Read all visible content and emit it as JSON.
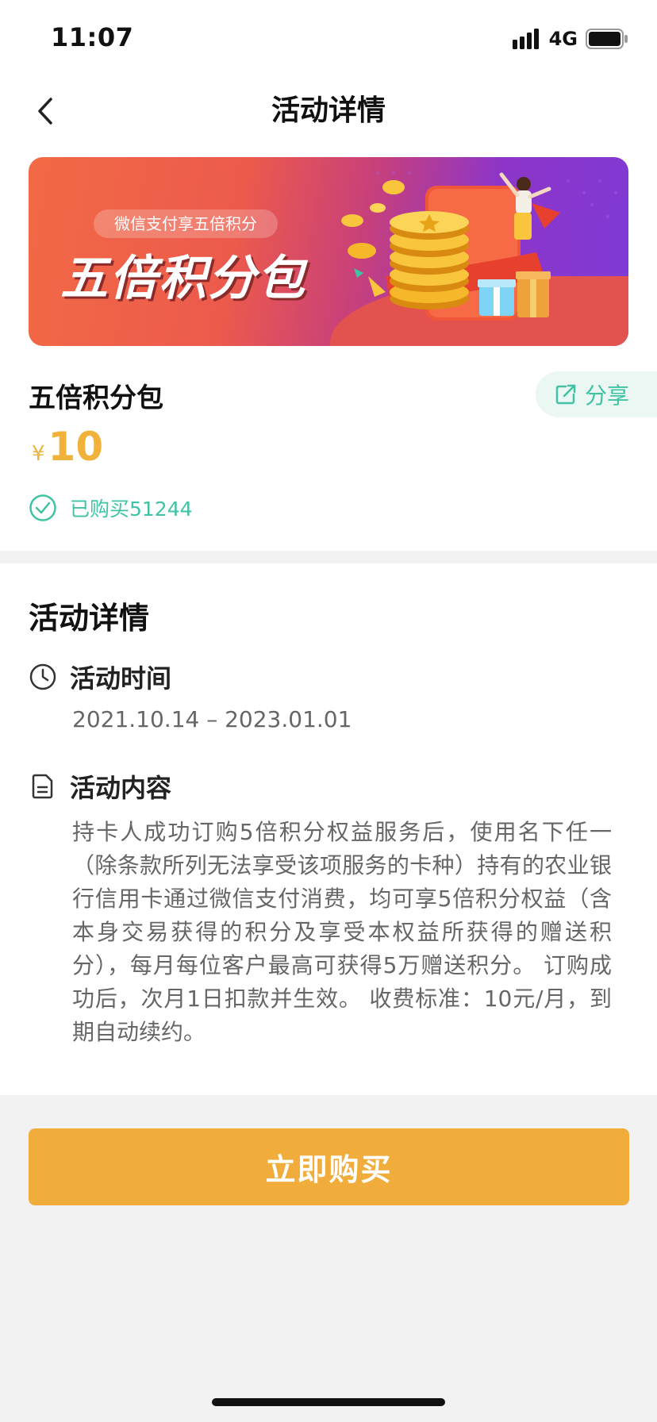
{
  "status_bar": {
    "time": "11:07",
    "network": "4G",
    "icons": [
      "signal-icon",
      "battery-icon"
    ]
  },
  "nav": {
    "title": "活动详情",
    "back_icon": "chevron-left-icon"
  },
  "banner": {
    "pill_text": "微信支付享五倍积分",
    "title": "五倍积分包"
  },
  "product": {
    "title": "五倍积分包",
    "share_label": "分享",
    "share_icon": "share-icon",
    "price_symbol": "¥",
    "price": "10",
    "bought_label": "已购买51244",
    "bought_icon": "check-circle-icon"
  },
  "details": {
    "heading": "活动详情",
    "time_section": {
      "label": "活动时间",
      "icon": "clock-icon",
      "value": "2021.10.14 – 2023.01.01"
    },
    "content_section": {
      "label": "活动内容",
      "icon": "document-icon",
      "text": "持卡人成功订购5倍积分权益服务后，使用名下任一（除条款所列无法享受该项服务的卡种）持有的农业银行信用卡通过微信支付消费，均可享5倍积分权益（含本身交易获得的积分及享受本权益所获得的赠送积分），每月每位客户最高可获得5万赠送积分。 订购成功后，次月1日扣款并生效。 收费标准：10元/月，到期自动续约。"
    }
  },
  "buy_button": {
    "label": "立即购买"
  },
  "colors": {
    "accent_teal": "#3fc3a4",
    "price_gold": "#f0b23a",
    "buy_orange": "#f0ad3b",
    "page_bg": "#f2f2f2"
  }
}
